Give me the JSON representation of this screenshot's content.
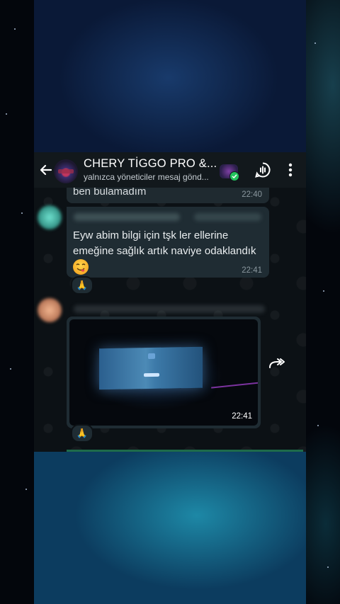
{
  "header": {
    "title": "CHERY TİGGO PRO &...",
    "subtitle": "yalnızca yöneticiler mesaj gönd..."
  },
  "messages": [
    {
      "text": "ben  bulamadım",
      "time": "22:40"
    },
    {
      "text": "Eyw abim bilgi için tşk ler ellerine emeğine sağlık artık naviye odaklandık",
      "emoji": "😋",
      "time": "22:41",
      "reaction": "🙏"
    },
    {
      "type": "image",
      "time": "22:41",
      "reaction": "🙏"
    }
  ],
  "icons": {
    "back": "arrow-left-icon",
    "voice_chat": "voice-chat-icon",
    "menu": "more-vert-icon",
    "forward": "forward-icon",
    "community_badge": "check-icon"
  },
  "colors": {
    "header_bg": "#12181c",
    "bubble_bg": "#1f2c33",
    "badge_green": "#23c35d"
  }
}
